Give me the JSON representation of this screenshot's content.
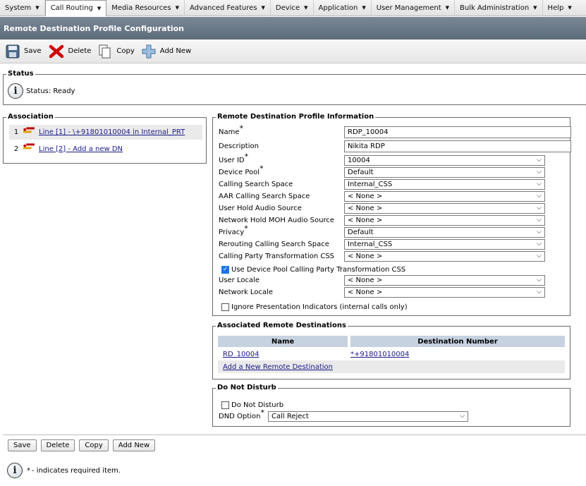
{
  "menu": [
    "System",
    "Call Routing",
    "Media Resources",
    "Advanced Features",
    "Device",
    "Application",
    "User Management",
    "Bulk Administration",
    "Help"
  ],
  "title": "Remote Destination Profile Configuration",
  "toolbar": {
    "save": "Save",
    "delete": "Delete",
    "copy": "Copy",
    "add_new": "Add New"
  },
  "status": {
    "legend": "Status",
    "text": "Status: Ready"
  },
  "association": {
    "legend": "Association",
    "items": [
      {
        "num": "1",
        "label": "Line [1] - \\+91801010004 in Internal_PRT"
      },
      {
        "num": "2",
        "label": "Line [2] - Add a new DN"
      }
    ]
  },
  "rdp_info": {
    "legend": "Remote Destination Profile Information",
    "name_label": "Name",
    "name_value": "RDP_10004",
    "description_label": "Description",
    "description_value": "Nikita RDP",
    "user_id_label": "User ID",
    "user_id_value": "10004",
    "device_pool_label": "Device Pool",
    "device_pool_value": "Default",
    "css_label": "Calling Search Space",
    "css_value": "Internal_CSS",
    "aar_css_label": "AAR Calling Search Space",
    "aar_css_value": "< None >",
    "user_hold_label": "User Hold Audio Source",
    "user_hold_value": "< None >",
    "network_hold_label": "Network Hold MOH Audio Source",
    "network_hold_value": "< None >",
    "privacy_label": "Privacy",
    "privacy_value": "Default",
    "rerouting_css_label": "Rerouting Calling Search Space",
    "rerouting_css_value": "Internal_CSS",
    "cpt_css_label": "Calling Party Transformation CSS",
    "cpt_css_value": "< None >",
    "use_dp_cpt_label": "Use Device Pool Calling Party Transformation CSS",
    "user_locale_label": "User Locale",
    "user_locale_value": "< None >",
    "network_locale_label": "Network Locale",
    "network_locale_value": "< None >",
    "ignore_pi_label": "Ignore Presentation Indicators (internal calls only)"
  },
  "assoc_remote": {
    "legend": "Associated Remote Destinations",
    "col_name": "Name",
    "col_number": "Destination Number",
    "row_name": "RD_10004",
    "row_number": "*+91801010004",
    "add_link": "Add a New Remote Destination"
  },
  "dnd": {
    "legend": "Do Not Disturb",
    "checkbox_label": "Do Not Disturb",
    "option_label": "DND Option",
    "option_value": "Call Reject"
  },
  "bottom_buttons": {
    "save": "Save",
    "delete": "Delete",
    "copy": "Copy",
    "add_new": "Add New"
  },
  "footer_note": "- indicates required item.",
  "required_mark": "*"
}
